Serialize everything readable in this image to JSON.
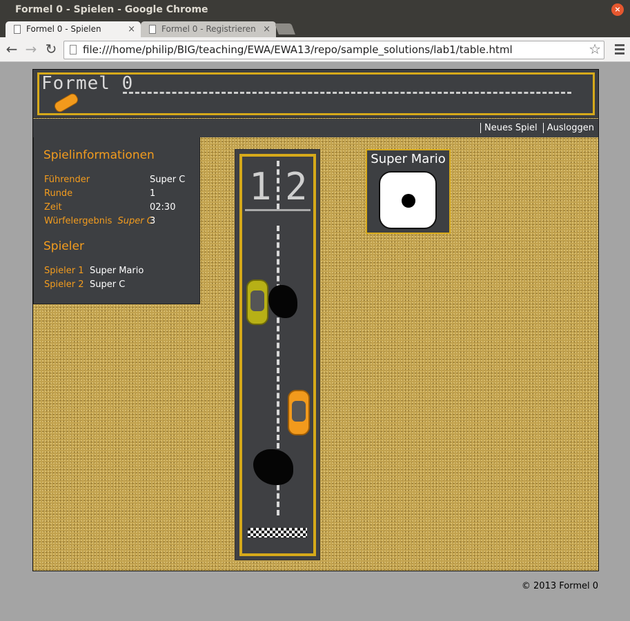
{
  "window": {
    "title": "Formel 0 - Spielen - Google Chrome",
    "close": "×"
  },
  "tabs": [
    {
      "label": "Formel 0 - Spielen",
      "close": "×"
    },
    {
      "label": "Formel 0 - Registrieren",
      "close": "×"
    }
  ],
  "toolbar": {
    "back": "←",
    "forward": "→",
    "reload": "↻",
    "url": "file:///home/philip/BIG/teaching/EWA/EWA13/repo/sample_solutions/lab1/table.html",
    "star": "☆"
  },
  "header": {
    "logo": "Formel 0"
  },
  "nav": {
    "new_game": "Neues Spiel",
    "logout": "Ausloggen"
  },
  "sidebar": {
    "info_title": "Spielinformationen",
    "info": {
      "leader_label": "Führender",
      "leader_value": "Super C",
      "round_label": "Runde",
      "round_value": "1",
      "time_label": "Zeit",
      "time_value": "02:30",
      "dice_label": "Würfelergebnis",
      "dice_player": "Super C",
      "dice_value": "3"
    },
    "players_title": "Spieler",
    "players": [
      {
        "label": "Spieler 1",
        "name": "Super Mario"
      },
      {
        "label": "Spieler 2",
        "name": "Super C"
      }
    ]
  },
  "track": {
    "lane1": "1",
    "lane2": "2"
  },
  "dice": {
    "player": "Super Mario",
    "pips": 1
  },
  "footer": {
    "text": "© 2013 Formel 0"
  },
  "colors": {
    "accent": "#f39c1e",
    "panel": "#3d3f42",
    "border": "#d6a91a",
    "sand": "#c2a24e"
  }
}
